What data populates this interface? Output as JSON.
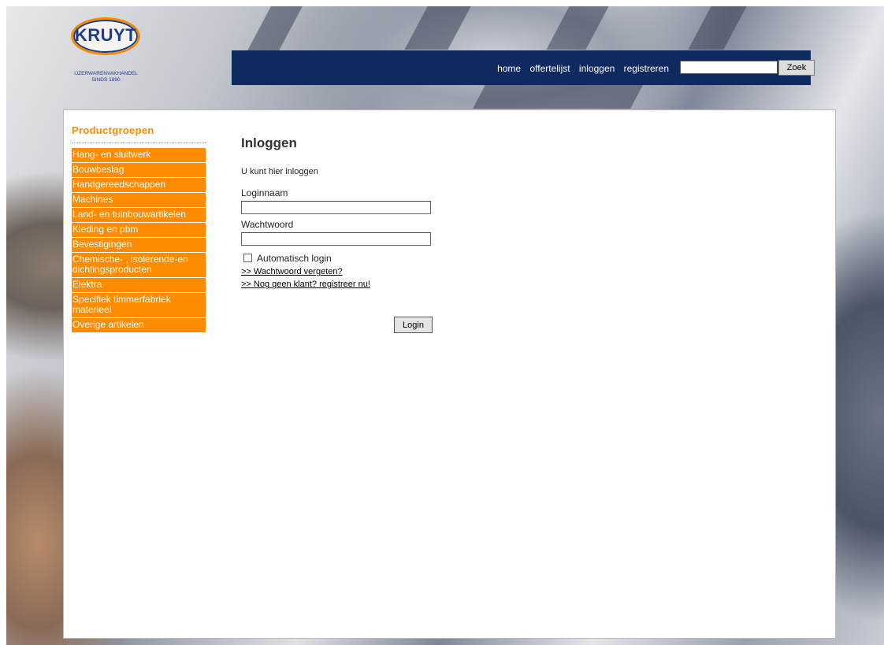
{
  "logo": {
    "brand": "KRUYT",
    "tagline": "IJZERWARENVAKHANDEL",
    "since": "SINDS 1890"
  },
  "topnav": {
    "items": [
      "home",
      "offertelijst",
      "inloggen",
      "registreren"
    ],
    "search_button": "Zoek",
    "search_value": ""
  },
  "sidebar": {
    "title": "Productgroepen",
    "items": [
      "Hang- en sluitwerk",
      "Bouwbeslag",
      "Handgereedschappen",
      "Machines",
      "Land- en tuinbouwartikelen",
      "Kleding en pbm",
      "Bevestigingen",
      "Chemische- , isolerende-en dichtingsproducten",
      "Elektra",
      "Specifiek timmerfabriek materieel",
      "Overige artikelen"
    ]
  },
  "login": {
    "title": "Inloggen",
    "intro": "U kunt hier inloggen",
    "username_label": "Loginnaam",
    "username_value": "",
    "password_label": "Wachtwoord",
    "password_value": "",
    "auto_login_label": "Automatisch login",
    "forgot_link": ">> Wachtwoord vergeten?",
    "register_link": ">> Nog geen klant? registreer nu!",
    "submit_label": "Login"
  },
  "colors": {
    "accent": "#ff8c00",
    "nav_bar": "#0e2a5e",
    "logo_blue": "#1c3d8c"
  }
}
